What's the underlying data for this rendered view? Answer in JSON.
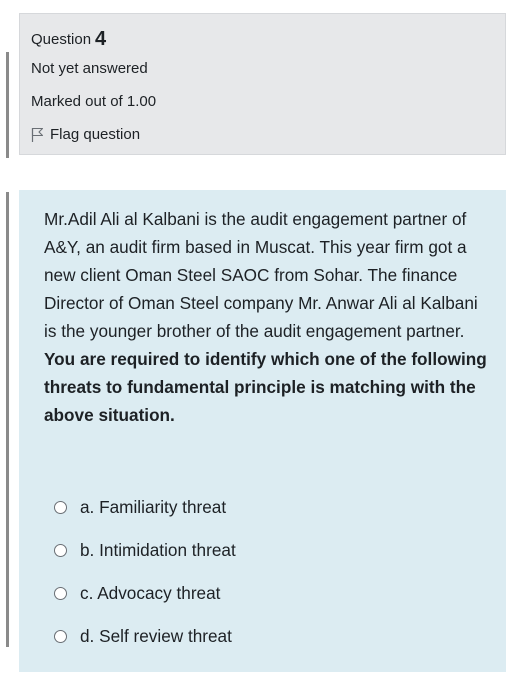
{
  "question_info": {
    "label": "Question",
    "number": "4",
    "state": "Not yet answered",
    "grade": "Marked out of 1.00",
    "flag_label": "Flag question"
  },
  "question": {
    "paragraph": "Mr.Adil Ali al Kalbani is the audit engagement partner of A&Y, an audit firm based in Muscat. This year firm got a new client Oman Steel SAOC from Sohar. The finance Director of Oman Steel company Mr. Anwar Ali al Kalbani is the younger brother of the audit engagement partner.",
    "instruction": "You are required to identify which one of the following threats to fundamental principle is matching with the above situation."
  },
  "answers": [
    {
      "label": "a. Familiarity threat",
      "selected": false
    },
    {
      "label": "b. Intimidation threat",
      "selected": false
    },
    {
      "label": "c. Advocacy threat",
      "selected": false
    },
    {
      "label": "d. Self review threat",
      "selected": false
    }
  ],
  "colors": {
    "info_background": "#e7e8ea",
    "content_background": "#dcecf2",
    "text": "#1d2125"
  },
  "icons": {
    "flag": "flag-icon",
    "radio": "radio-unchecked-icon"
  }
}
